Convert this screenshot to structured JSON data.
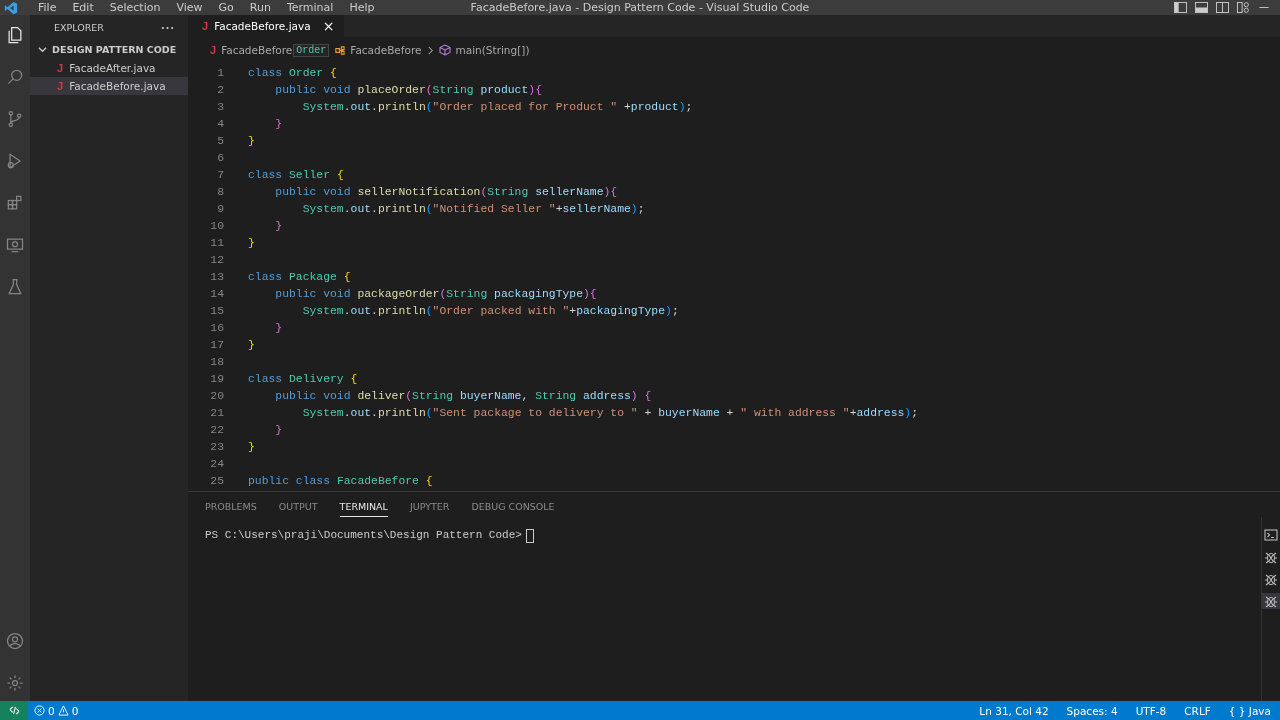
{
  "menu": [
    "File",
    "Edit",
    "Selection",
    "View",
    "Go",
    "Run",
    "Terminal",
    "Help"
  ],
  "window": {
    "title": "FacadeBefore.java - Design Pattern Code - Visual Studio Code"
  },
  "activity_bar": [
    {
      "kind": "files",
      "selected": true
    },
    {
      "kind": "search",
      "selected": false
    },
    {
      "kind": "git",
      "selected": false
    },
    {
      "kind": "debug",
      "selected": false
    },
    {
      "kind": "extensions",
      "selected": false
    },
    {
      "kind": "remote",
      "selected": false
    },
    {
      "kind": "testing",
      "selected": false
    }
  ],
  "sidebar": {
    "title": "EXPLORER",
    "folder": {
      "name": "DESIGN PATTERN CODE",
      "expanded": true
    },
    "items": [
      {
        "icon": "J",
        "name": "FacadeAfter.java",
        "selected": false
      },
      {
        "icon": "J",
        "name": "FacadeBefore.java",
        "selected": true
      }
    ]
  },
  "tabs": [
    {
      "icon": "J",
      "label": "FacadeBefore.java",
      "close": "×",
      "selected": true
    }
  ],
  "breadcrumbs": {
    "icon": "J",
    "items": [
      "FacadeBefore",
      "FacadeBefore",
      "main(String[])"
    ],
    "hover": "Order"
  },
  "code": [
    {
      "n": "1",
      "tokens": [
        {
          "kind": "kw",
          "text": "class "
        },
        {
          "kind": "type",
          "text": "Order "
        },
        {
          "kind": "b1",
          "text": "{"
        }
      ]
    },
    {
      "n": "2",
      "tokens": [
        {
          "kind": "kw",
          "text": "    public void "
        },
        {
          "kind": "fn",
          "text": "placeOrder"
        },
        {
          "kind": "b2",
          "text": "("
        },
        {
          "kind": "type",
          "text": "String "
        },
        {
          "kind": "param",
          "text": "product"
        },
        {
          "kind": "b2",
          "text": "){"
        }
      ]
    },
    {
      "n": "3",
      "tokens": [
        {
          "kind": "type",
          "text": "        System"
        },
        {
          "kind": "plain",
          "text": "."
        },
        {
          "kind": "param",
          "text": "out"
        },
        {
          "kind": "plain",
          "text": "."
        },
        {
          "kind": "fn",
          "text": "println"
        },
        {
          "kind": "b3",
          "text": "("
        },
        {
          "kind": "str",
          "text": "\"Order placed for Product \""
        },
        {
          "kind": "plain",
          "text": " +"
        },
        {
          "kind": "param",
          "text": "product"
        },
        {
          "kind": "b3",
          "text": ")"
        },
        {
          "kind": "plain",
          "text": ";"
        }
      ]
    },
    {
      "n": "4",
      "tokens": [
        {
          "kind": "b2",
          "text": "    }"
        }
      ]
    },
    {
      "n": "5",
      "tokens": [
        {
          "kind": "b1",
          "text": "}"
        }
      ]
    },
    {
      "n": "6"
    },
    {
      "n": "7",
      "tokens": [
        {
          "kind": "kw",
          "text": "class "
        },
        {
          "kind": "type",
          "text": "Seller "
        },
        {
          "kind": "b1",
          "text": "{"
        }
      ]
    },
    {
      "n": "8",
      "tokens": [
        {
          "kind": "kw",
          "text": "    public void "
        },
        {
          "kind": "fn",
          "text": "sellerNotification"
        },
        {
          "kind": "b2",
          "text": "("
        },
        {
          "kind": "type",
          "text": "String "
        },
        {
          "kind": "param",
          "text": "sellerName"
        },
        {
          "kind": "b2",
          "text": "){"
        }
      ]
    },
    {
      "n": "9",
      "tokens": [
        {
          "kind": "type",
          "text": "        System"
        },
        {
          "kind": "plain",
          "text": "."
        },
        {
          "kind": "param",
          "text": "out"
        },
        {
          "kind": "plain",
          "text": "."
        },
        {
          "kind": "fn",
          "text": "println"
        },
        {
          "kind": "b3",
          "text": "("
        },
        {
          "kind": "str",
          "text": "\"Notified Seller \""
        },
        {
          "kind": "plain",
          "text": "+"
        },
        {
          "kind": "param",
          "text": "sellerName"
        },
        {
          "kind": "b3",
          "text": ")"
        },
        {
          "kind": "plain",
          "text": ";"
        }
      ]
    },
    {
      "n": "10",
      "tokens": [
        {
          "kind": "b2",
          "text": "    }"
        }
      ]
    },
    {
      "n": "11",
      "tokens": [
        {
          "kind": "b1",
          "text": "}"
        }
      ]
    },
    {
      "n": "12"
    },
    {
      "n": "13",
      "tokens": [
        {
          "kind": "kw",
          "text": "class "
        },
        {
          "kind": "type",
          "text": "Package "
        },
        {
          "kind": "b1",
          "text": "{"
        }
      ]
    },
    {
      "n": "14",
      "tokens": [
        {
          "kind": "kw",
          "text": "    public void "
        },
        {
          "kind": "fn",
          "text": "packageOrder"
        },
        {
          "kind": "b2",
          "text": "("
        },
        {
          "kind": "type",
          "text": "String "
        },
        {
          "kind": "param",
          "text": "packagingType"
        },
        {
          "kind": "b2",
          "text": "){"
        }
      ]
    },
    {
      "n": "15",
      "tokens": [
        {
          "kind": "type",
          "text": "        System"
        },
        {
          "kind": "plain",
          "text": "."
        },
        {
          "kind": "param",
          "text": "out"
        },
        {
          "kind": "plain",
          "text": "."
        },
        {
          "kind": "fn",
          "text": "println"
        },
        {
          "kind": "b3",
          "text": "("
        },
        {
          "kind": "str",
          "text": "\"Order packed with \""
        },
        {
          "kind": "plain",
          "text": "+"
        },
        {
          "kind": "param",
          "text": "packagingType"
        },
        {
          "kind": "b3",
          "text": ")"
        },
        {
          "kind": "plain",
          "text": ";"
        }
      ]
    },
    {
      "n": "16",
      "tokens": [
        {
          "kind": "b2",
          "text": "    }"
        }
      ]
    },
    {
      "n": "17",
      "tokens": [
        {
          "kind": "b1",
          "text": "}"
        }
      ]
    },
    {
      "n": "18"
    },
    {
      "n": "19",
      "tokens": [
        {
          "kind": "kw",
          "text": "class "
        },
        {
          "kind": "type",
          "text": "Delivery "
        },
        {
          "kind": "b1",
          "text": "{"
        }
      ]
    },
    {
      "n": "20",
      "tokens": [
        {
          "kind": "kw",
          "text": "    public void "
        },
        {
          "kind": "fn",
          "text": "deliver"
        },
        {
          "kind": "b2",
          "text": "("
        },
        {
          "kind": "type",
          "text": "String "
        },
        {
          "kind": "param",
          "text": "buyerName"
        },
        {
          "kind": "plain",
          "text": ", "
        },
        {
          "kind": "type",
          "text": "String "
        },
        {
          "kind": "param",
          "text": "address"
        },
        {
          "kind": "b2",
          "text": ") {"
        }
      ]
    },
    {
      "n": "21",
      "tokens": [
        {
          "kind": "type",
          "text": "        System"
        },
        {
          "kind": "plain",
          "text": "."
        },
        {
          "kind": "param",
          "text": "out"
        },
        {
          "kind": "plain",
          "text": "."
        },
        {
          "kind": "fn",
          "text": "println"
        },
        {
          "kind": "b3",
          "text": "("
        },
        {
          "kind": "str",
          "text": "\"Sent package to delivery to \""
        },
        {
          "kind": "plain",
          "text": " + "
        },
        {
          "kind": "param",
          "text": "buyerName"
        },
        {
          "kind": "plain",
          "text": " + "
        },
        {
          "kind": "str",
          "text": "\" with address \""
        },
        {
          "kind": "plain",
          "text": "+"
        },
        {
          "kind": "param",
          "text": "address"
        },
        {
          "kind": "b3",
          "text": ")"
        },
        {
          "kind": "plain",
          "text": ";"
        }
      ]
    },
    {
      "n": "22",
      "tokens": [
        {
          "kind": "b2",
          "text": "    }"
        }
      ]
    },
    {
      "n": "23",
      "tokens": [
        {
          "kind": "b1",
          "text": "}"
        }
      ]
    },
    {
      "n": "24"
    },
    {
      "n": "25",
      "tokens": [
        {
          "kind": "kw",
          "text": "public class "
        },
        {
          "kind": "type",
          "text": "FacadeBefore "
        },
        {
          "kind": "b1",
          "text": "{"
        }
      ]
    }
  ],
  "panel": {
    "tabs": [
      {
        "label": "PROBLEMS",
        "selected": false
      },
      {
        "label": "OUTPUT",
        "selected": false
      },
      {
        "label": "TERMINAL",
        "selected": true
      },
      {
        "label": "JUPYTER",
        "selected": false
      },
      {
        "label": "DEBUG CONSOLE",
        "selected": false
      }
    ],
    "prompt": "PS C:\\Users\\praji\\Documents\\Design Pattern Code>",
    "terminals": [
      {
        "kind": "shell",
        "selected": false
      },
      {
        "kind": "debug",
        "selected": false
      },
      {
        "kind": "debug",
        "selected": false
      },
      {
        "kind": "debug",
        "selected": true
      }
    ]
  },
  "status_bar": {
    "errors": "0",
    "warnings": "0",
    "right": [
      "Ln 31, Col 42",
      "Spaces: 4",
      "UTF-8",
      "CRLF"
    ],
    "language_icon": "{ }",
    "language": "Java"
  }
}
